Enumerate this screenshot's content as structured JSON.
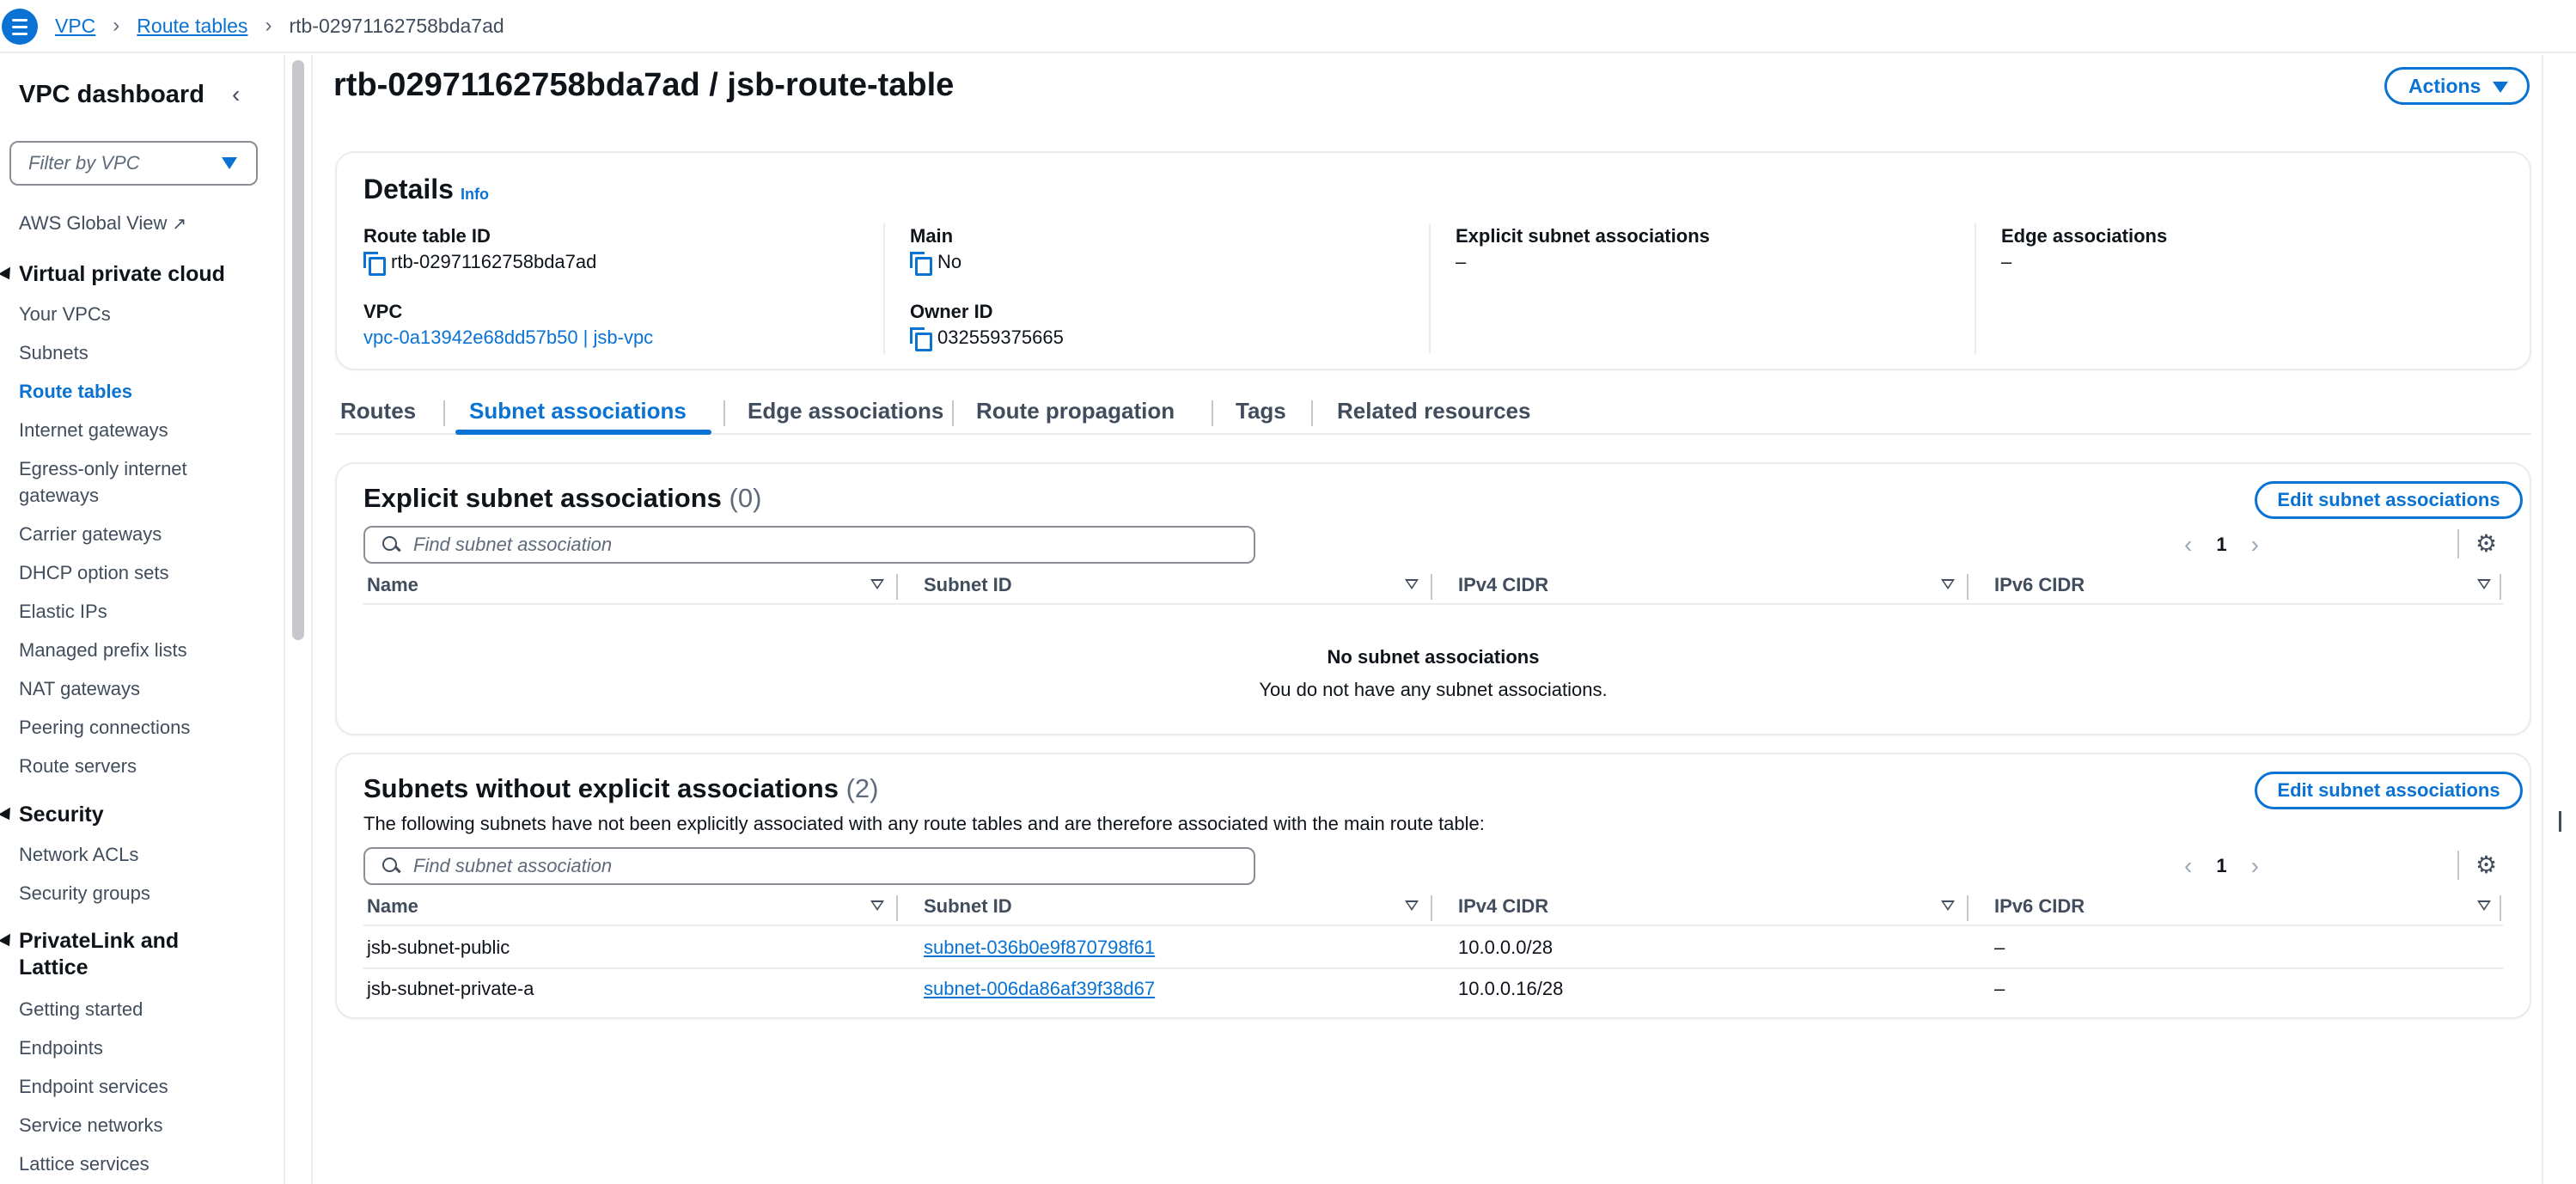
{
  "breadcrumb": {
    "items": [
      "VPC",
      "Route tables"
    ],
    "current": "rtb-02971162758bda7ad"
  },
  "sidebar": {
    "title": "VPC dashboard",
    "filter_placeholder": "Filter by VPC",
    "global_view": "AWS Global View",
    "sections": {
      "vpc": {
        "label": "Virtual private cloud",
        "items": [
          "Your VPCs",
          "Subnets",
          "Route tables",
          "Internet gateways",
          "Egress-only internet gateways",
          "Carrier gateways",
          "DHCP option sets",
          "Elastic IPs",
          "Managed prefix lists",
          "NAT gateways",
          "Peering connections",
          "Route servers"
        ]
      },
      "security": {
        "label": "Security",
        "items": [
          "Network ACLs",
          "Security groups"
        ]
      },
      "privatelink": {
        "label": "PrivateLink and Lattice",
        "items": [
          "Getting started",
          "Endpoints",
          "Endpoint services",
          "Service networks",
          "Lattice services"
        ]
      }
    }
  },
  "page": {
    "title": "rtb-02971162758bda7ad / jsb-route-table",
    "actions_label": "Actions"
  },
  "details": {
    "title": "Details",
    "info": "Info",
    "route_table_id_label": "Route table ID",
    "route_table_id": "rtb-02971162758bda7ad",
    "main_label": "Main",
    "main_value": "No",
    "explicit_label": "Explicit subnet associations",
    "explicit_value": "–",
    "edge_label": "Edge associations",
    "edge_value": "–",
    "vpc_label": "VPC",
    "vpc_value": "vpc-0a13942e68dd57b50 | jsb-vpc",
    "owner_label": "Owner ID",
    "owner_value": "032559375665"
  },
  "tabs": [
    "Routes",
    "Subnet associations",
    "Edge associations",
    "Route propagation",
    "Tags",
    "Related resources"
  ],
  "explicit": {
    "title": "Explicit subnet associations",
    "count": "(0)",
    "edit_label": "Edit subnet associations",
    "search_placeholder": "Find subnet association",
    "page": "1",
    "columns": [
      "Name",
      "Subnet ID",
      "IPv4 CIDR",
      "IPv6 CIDR"
    ],
    "empty_title": "No subnet associations",
    "empty_desc": "You do not have any subnet associations."
  },
  "without": {
    "title": "Subnets without explicit associations",
    "count": "(2)",
    "description": "The following subnets have not been explicitly associated with any route tables and are therefore associated with the main route table:",
    "edit_label": "Edit subnet associations",
    "search_placeholder": "Find subnet association",
    "page": "1",
    "columns": [
      "Name",
      "Subnet ID",
      "IPv4 CIDR",
      "IPv6 CIDR"
    ],
    "rows": [
      {
        "name": "jsb-subnet-public",
        "subnet_id": "subnet-036b0e9f870798f61",
        "ipv4": "10.0.0.0/28",
        "ipv6": "–"
      },
      {
        "name": "jsb-subnet-private-a",
        "subnet_id": "subnet-006da86af39f38d67",
        "ipv4": "10.0.0.16/28",
        "ipv6": "–"
      }
    ]
  }
}
